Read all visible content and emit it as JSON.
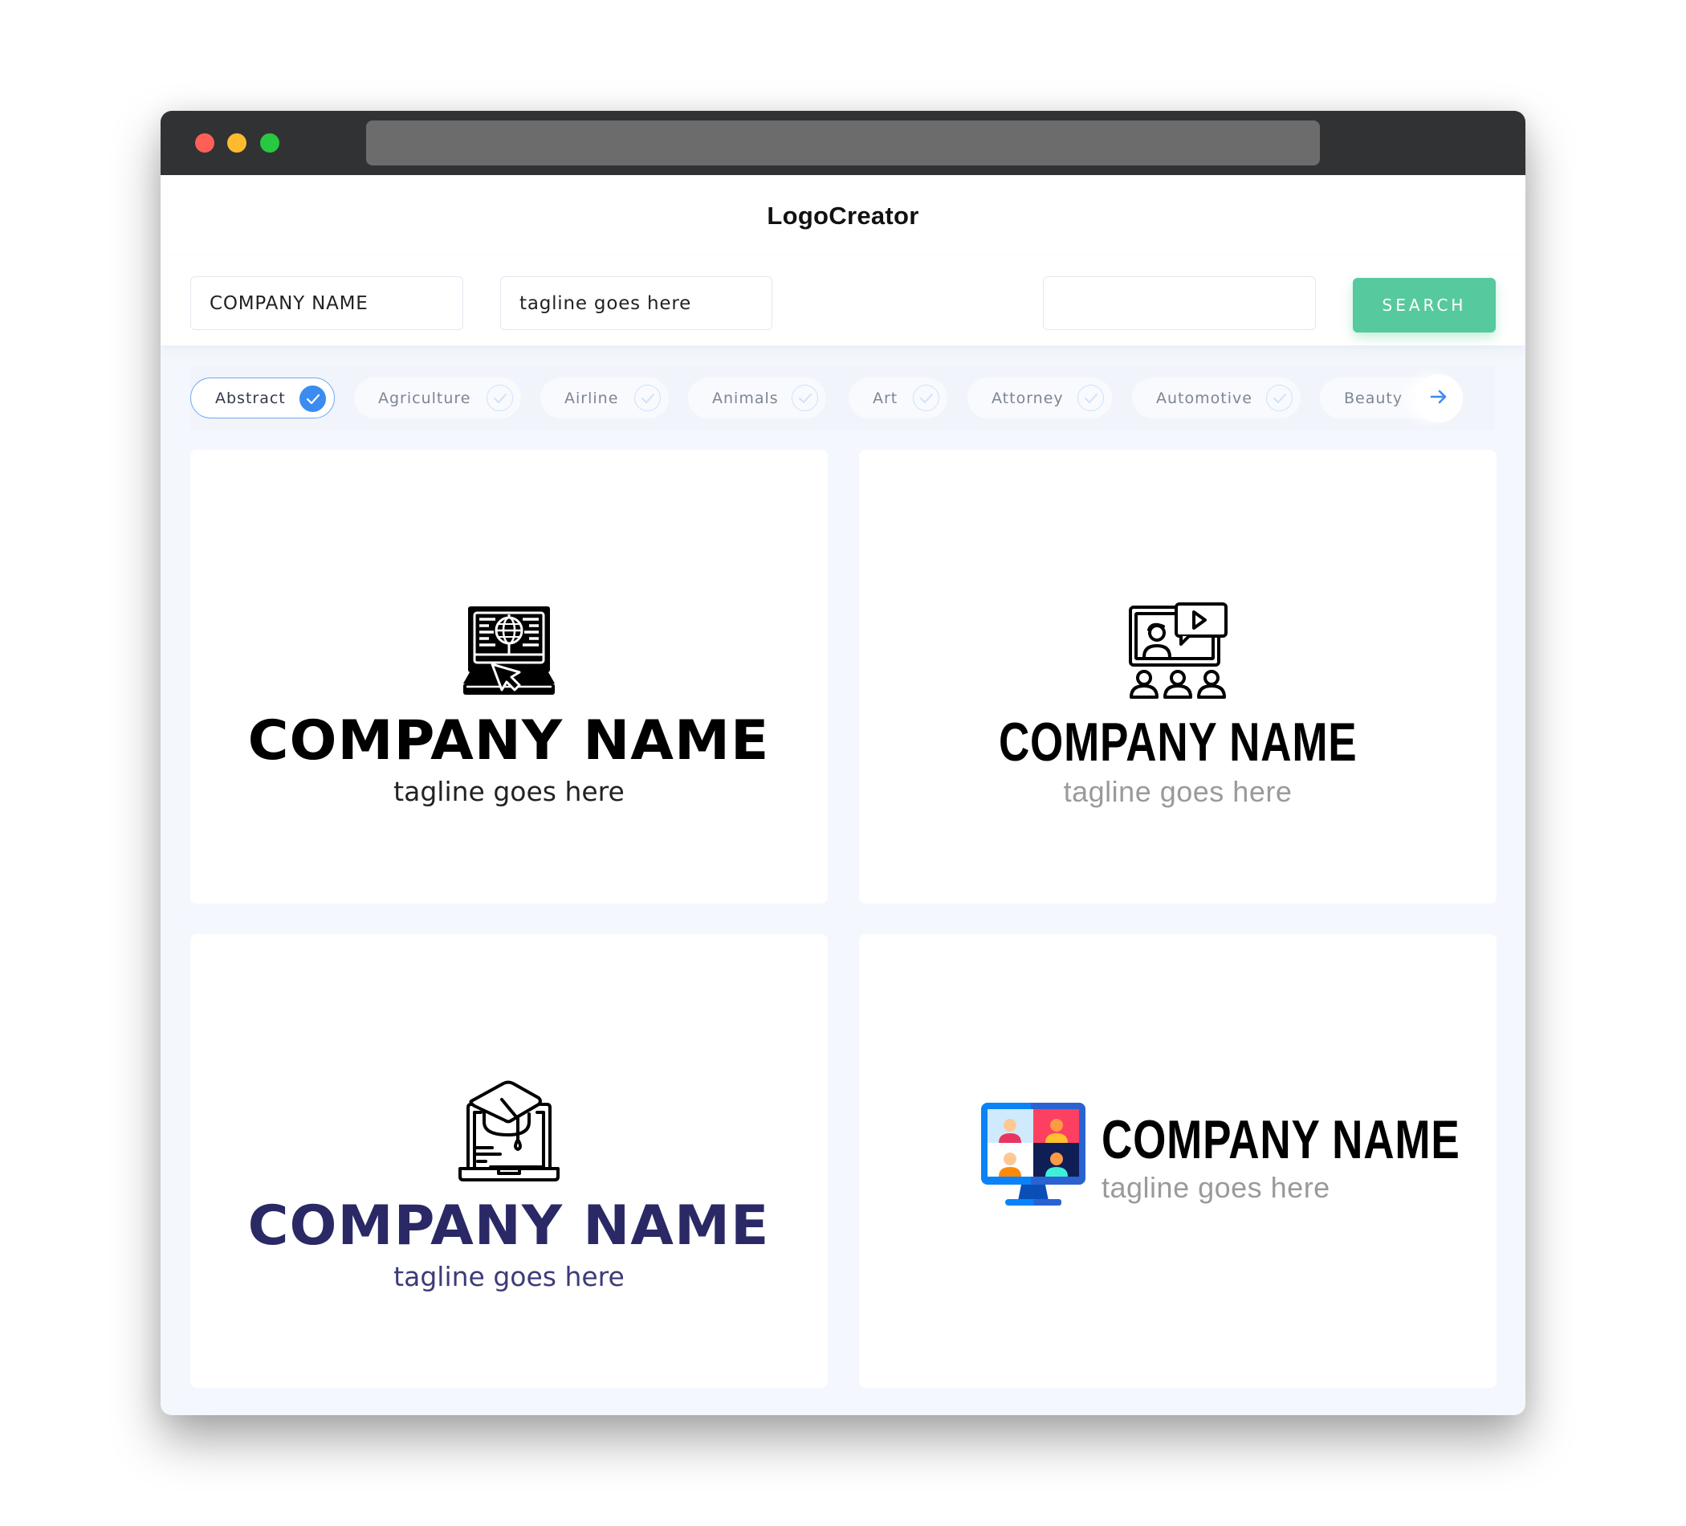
{
  "window": {
    "title_bar": {
      "buttons": [
        "close",
        "minimize",
        "maximize"
      ]
    },
    "address_bar": {
      "value": ""
    }
  },
  "header": {
    "brand": "LogoCreator"
  },
  "search": {
    "company_name_value": "COMPANY NAME",
    "tagline_value": "tagline goes here",
    "extra_value": "",
    "button_label": "SEARCH"
  },
  "categories": {
    "items": [
      {
        "label": "Abstract",
        "selected": true
      },
      {
        "label": "Agriculture",
        "selected": false
      },
      {
        "label": "Airline",
        "selected": false
      },
      {
        "label": "Animals",
        "selected": false
      },
      {
        "label": "Art",
        "selected": false
      },
      {
        "label": "Attorney",
        "selected": false
      },
      {
        "label": "Automotive",
        "selected": false
      },
      {
        "label": "Beauty",
        "selected": false
      }
    ],
    "next_icon": "arrow-right-icon"
  },
  "logos": [
    {
      "company_name": "COMPANY NAME",
      "tagline": "tagline goes here",
      "icon": "laptop-globe-cursor-icon",
      "name_color": "#000000",
      "tagline_color": "#222222"
    },
    {
      "company_name": "COMPANY NAME",
      "tagline": "tagline goes here",
      "icon": "video-presentation-audience-icon",
      "name_color": "#000000",
      "tagline_color": "#9a9a9a"
    },
    {
      "company_name": "COMPANY NAME",
      "tagline": "tagline goes here",
      "icon": "laptop-graduation-cap-icon",
      "name_color": "#2a2966",
      "tagline_color": "#3d3b78"
    },
    {
      "company_name": "COMPANY NAME",
      "tagline": "tagline goes here",
      "icon": "monitor-video-conference-icon",
      "name_color": "#000000",
      "tagline_color": "#9a9a9a"
    }
  ],
  "colors": {
    "accent_green": "#57c99e",
    "accent_blue": "#3a8cf0",
    "titlebar": "#313234",
    "page_bg": "#f4f7fd"
  }
}
